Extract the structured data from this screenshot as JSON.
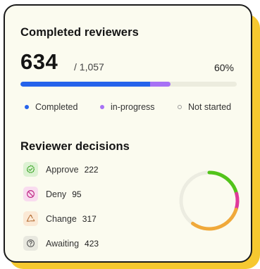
{
  "completed_reviewers": {
    "title": "Completed reviewers",
    "completed_count": "634",
    "total_label": "/ 1,057",
    "percent_label": "60%",
    "completed_fraction": 0.6,
    "in_progress_fraction": 0.095,
    "legend": [
      {
        "label": "Completed",
        "color": "#2563eb"
      },
      {
        "label": "in-progress",
        "color": "#a772f5"
      },
      {
        "label": "Not started",
        "color": "#9a9a9a"
      }
    ]
  },
  "reviewer_decisions": {
    "title": "Reviewer decisions",
    "items": [
      {
        "label": "Approve",
        "count": "222",
        "icon": "check-badge-icon",
        "color": "#52c41a"
      },
      {
        "label": "Deny",
        "count": "95",
        "icon": "prohibited-icon",
        "color": "#e0399b"
      },
      {
        "label": "Change",
        "count": "317",
        "icon": "recycle-icon",
        "color": "#f0a93a"
      },
      {
        "label": "Awaiting",
        "count": "423",
        "icon": "question-circle-icon",
        "color": "#e8e8df"
      }
    ]
  },
  "colors": {
    "accent_blue": "#2563eb",
    "accent_purple": "#a772f5",
    "card_shadow": "#f6c830",
    "card_background": "#fbfbef"
  }
}
